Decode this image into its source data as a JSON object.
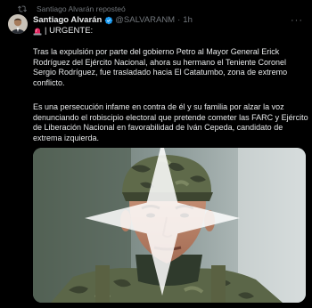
{
  "repost": {
    "label": "Santiago Alvarán reposteó",
    "icon": "repost-icon"
  },
  "author": {
    "name": "Santiago Alvarán",
    "handle": "@SALVARANM",
    "separator": "·",
    "time": "1h",
    "verified_color": "#1d9bf0",
    "avatar_icon": "avatar-photo"
  },
  "tweet": {
    "urgent_label": "| URGENTE:",
    "urgent_icon": "siren-icon",
    "paragraph_1": "Tras la expulsión por parte del gobierno Petro al Mayor General Erick Rodríguez del Ejército Nacional, ahora su hermano el Teniente Coronel Sergio Rodríguez, fue trasladado hacia El Catatumbo, zona de extremo conflicto.",
    "paragraph_2": "Es una persecución infame en contra de él y su familia por alzar la voz denunciando el robiscipio electoral que pretende cometer las FARC y Ejército de Liberación Nacional en favorabilidad de Iván Cepeda, candidato de extrema izquierda.",
    "more_icon": "more-icon"
  },
  "media": {
    "photo_icon": "soldier-portrait-photo",
    "overlay_icon": "sparkle-icon"
  },
  "colors": {
    "background": "#000000",
    "text": "#e7e9ea",
    "secondary": "#71767b",
    "accent": "#1d9bf0"
  }
}
